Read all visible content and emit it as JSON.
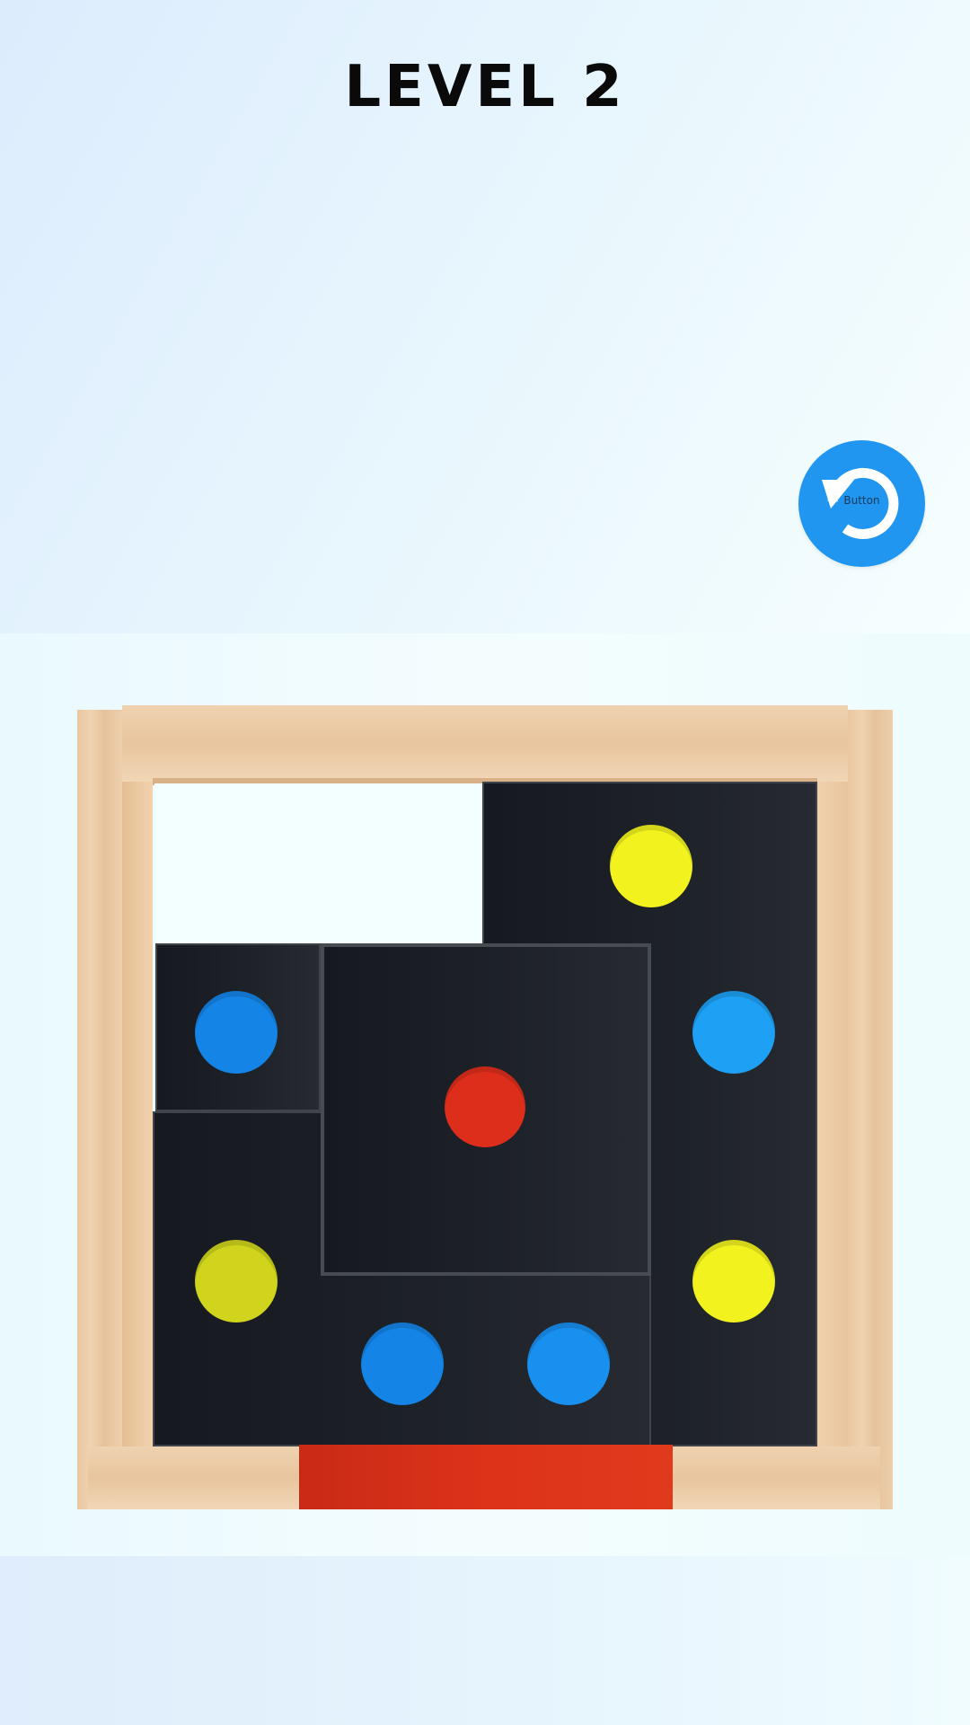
{
  "header": {
    "level_title": "LEVEL 2"
  },
  "controls": {
    "restart_button_label": "Button",
    "restart_icon": "restart-icon",
    "accent_color": "#2196f0"
  },
  "board": {
    "frame_color": "#ecccaa",
    "block_color": "#1c1f25",
    "exit_color": "#dc3319",
    "dot_colors": {
      "yellow": "#f2f21e",
      "olive_yellow": "#d0d41c",
      "blue": "#1484e6",
      "light_blue": "#1ea0f4",
      "red": "#dd2e1b"
    }
  }
}
